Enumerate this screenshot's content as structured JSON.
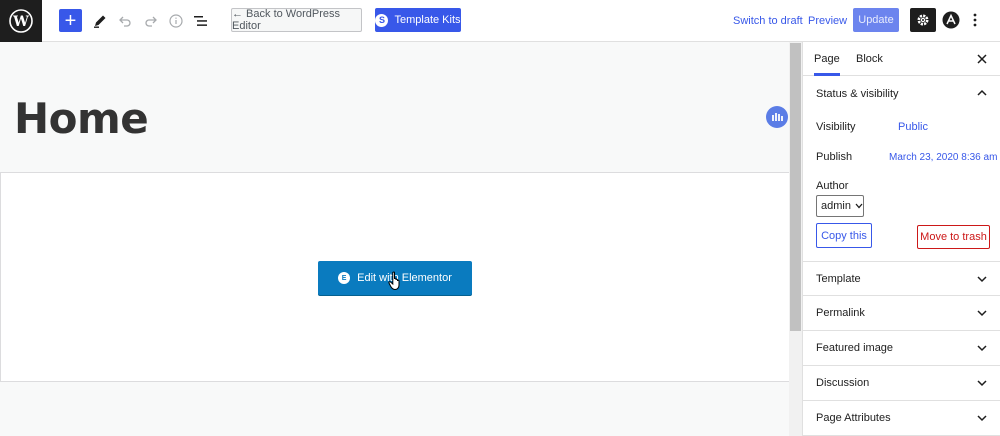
{
  "toolbar": {
    "back_label": "← Back to WordPress Editor",
    "kits_label": "Template Kits",
    "switch_draft": "Switch to draft",
    "preview": "Preview",
    "update": "Update"
  },
  "canvas": {
    "page_title": "Home",
    "elementor_button": "Edit with Elementor"
  },
  "sidebar": {
    "tabs": [
      {
        "label": "Page",
        "active": true
      },
      {
        "label": "Block",
        "active": false
      }
    ],
    "status_section": {
      "title": "Status & visibility",
      "visibility_label": "Visibility",
      "visibility_value": "Public",
      "publish_label": "Publish",
      "publish_value": "March 23, 2020 8:36 am",
      "author_label": "Author",
      "author_value": "admin",
      "copy_button": "Copy this",
      "trash_button": "Move to trash"
    },
    "panels": [
      {
        "title": "Template"
      },
      {
        "title": "Permalink"
      },
      {
        "title": "Featured image"
      },
      {
        "title": "Discussion"
      },
      {
        "title": "Page Attributes"
      }
    ]
  },
  "colors": {
    "accent": "#3858e9",
    "elementor": "#0a7bbf",
    "danger": "#cc1818"
  }
}
